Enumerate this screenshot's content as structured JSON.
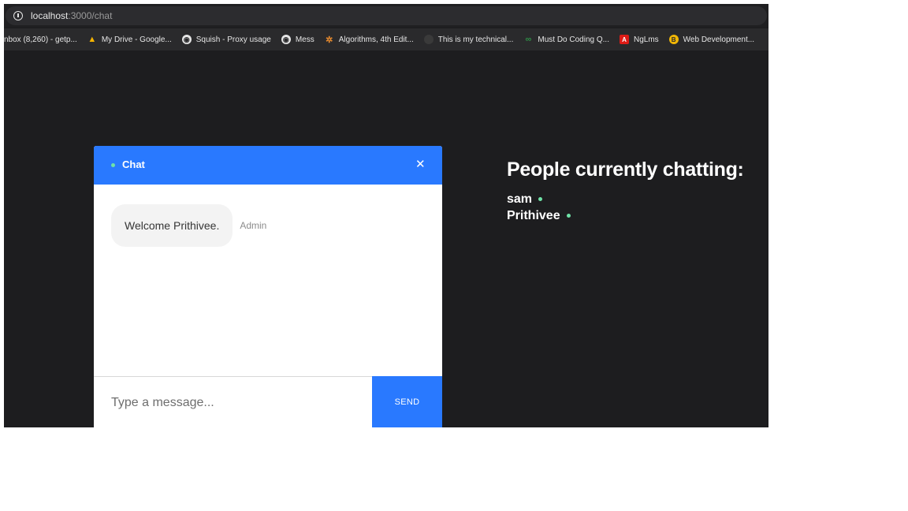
{
  "browser": {
    "url_host": "localhost",
    "url_path": ":3000/chat",
    "bookmarks": [
      {
        "label": "nbox (8,260) - getp...",
        "icon": "",
        "icon_color": ""
      },
      {
        "label": "My Drive - Google...",
        "icon": "google-drive-icon",
        "icon_color": "#f6b400"
      },
      {
        "label": "Squish - Proxy usage",
        "icon": "globe-icon",
        "icon_color": "#e6e6e6"
      },
      {
        "label": "Mess",
        "icon": "globe-icon",
        "icon_color": "#e6e6e6"
      },
      {
        "label": "Algorithms, 4th Edit...",
        "icon": "algorithms-icon",
        "icon_color": "#e88b2e"
      },
      {
        "label": "This is my technical...",
        "icon": "github-icon",
        "icon_color": "#3a3a3a"
      },
      {
        "label": "Must Do Coding Q...",
        "icon": "geeksforgeeks-icon",
        "icon_color": "#2f8d46"
      },
      {
        "label": "NgLms",
        "icon": "angular-icon",
        "icon_color": "#dd1b16"
      },
      {
        "label": "Web Development...",
        "icon": "bookmark-badge-icon",
        "icon_color": "#f2b705"
      }
    ]
  },
  "chat": {
    "title": "Chat",
    "close_glyph": "✕",
    "messages": [
      {
        "text": "Welcome Prithivee.",
        "sender": "Admin"
      }
    ],
    "input_placeholder": "Type a message...",
    "send_label": "SEND"
  },
  "people": {
    "heading": "People currently chatting:",
    "users": [
      "sam",
      "Prithivee"
    ]
  },
  "colors": {
    "accent": "#2979ff",
    "online": "#6fe3a7",
    "background": "#1d1d1f"
  }
}
